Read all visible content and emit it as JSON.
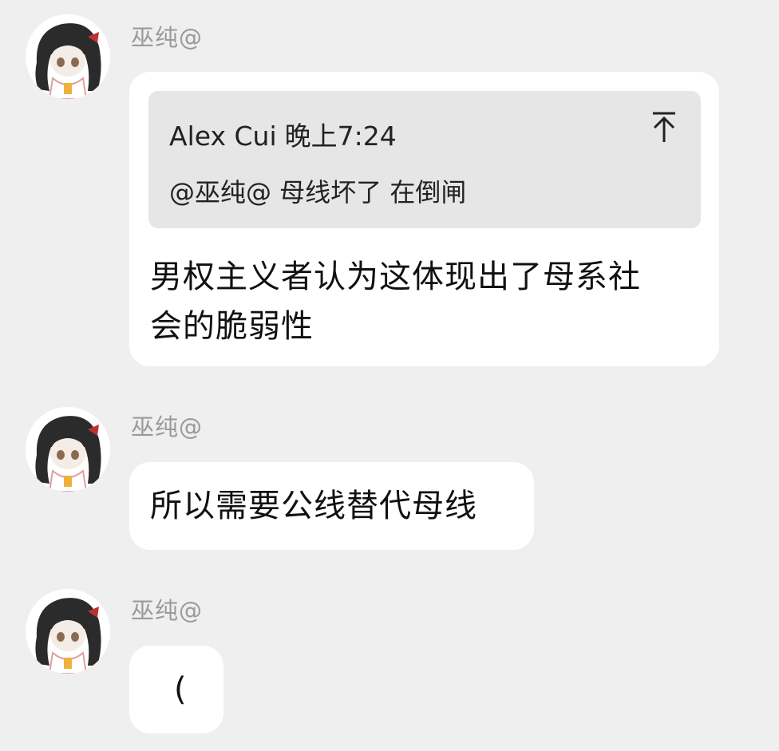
{
  "messages": [
    {
      "sender": "巫纯@",
      "quote": {
        "author": "Alex Cui",
        "time": "晚上7:24",
        "text": "@巫纯@ 母线坏了 在倒闸"
      },
      "text_lines": [
        "男权主义者认为这体现出了母系社",
        "会的脆弱性"
      ]
    },
    {
      "sender": "巫纯@",
      "text": "所以需要公线替代母线"
    },
    {
      "sender": "巫纯@",
      "text": "("
    }
  ]
}
